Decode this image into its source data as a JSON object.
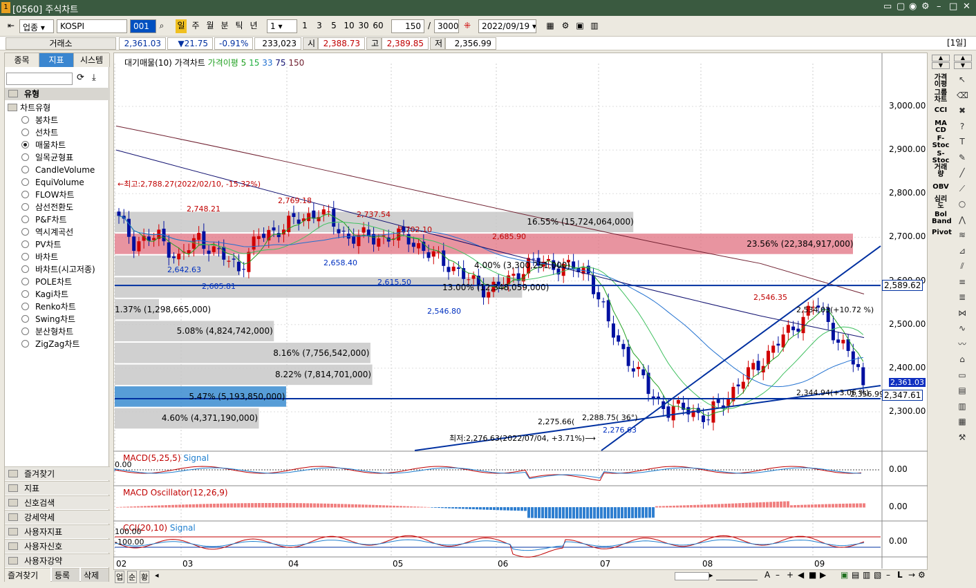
{
  "window": {
    "title": "[0560] 주식차트",
    "controls": [
      "□",
      "▢",
      "◉",
      "⚙",
      "–",
      "□",
      "✕"
    ]
  },
  "toolbar": {
    "market": "업종",
    "symbol": "KOSPI",
    "code": "001",
    "periods": [
      "일",
      "주",
      "월",
      "분",
      "틱",
      "년"
    ],
    "interval": "1",
    "quick": [
      "1",
      "3",
      "5",
      "10",
      "30",
      "60"
    ],
    "count": "150",
    "total": "3000",
    "date": "2022/09/19"
  },
  "pricebar": {
    "exchange": "거래소",
    "price": "2,361.03",
    "change": "▼21.75",
    "pct": "-0.91%",
    "volume": "233,023",
    "open_l": "시",
    "open": "2,388.73",
    "high_l": "고",
    "high": "2,389.85",
    "low_l": "저",
    "low": "2,356.99",
    "period": "[1일]"
  },
  "left": {
    "tabs": [
      "종목",
      "지표",
      "시스템"
    ],
    "section": "유형",
    "group": "차트유형",
    "types": [
      "봉차트",
      "선차트",
      "매물차트",
      "일목균형표",
      "CandleVolume",
      "EquiVolume",
      "FLOW차트",
      "삼선전환도",
      "P&F차트",
      "역시계곡선",
      "PV차트",
      "바차트",
      "바차트(시고저종)",
      "POLE차트",
      "Kagi차트",
      "Renko차트",
      "Swing차트",
      "분산형차트",
      "ZigZag차트"
    ],
    "selected": "매물차트",
    "bottom": [
      "즐겨찾기",
      "지표",
      "신호검색",
      "강세약세",
      "사용자지표",
      "사용자신호",
      "사용자강약"
    ],
    "footer": [
      "즐겨찾기",
      "등록",
      "삭제"
    ]
  },
  "legend": {
    "a": "대기매물(10)",
    "b": "가격차트",
    "c": "가격이평 5",
    "d": "15",
    "e": "33",
    "f": "75",
    "g": "150"
  },
  "macd": {
    "name": "MACD(5,25,5)",
    "sig": "Signal",
    "zero": "0.00",
    "val": "0.00"
  },
  "osc": {
    "name": "MACD Oscillator(12,26,9)",
    "val": "0.00"
  },
  "cci": {
    "name": "CCI(20,10)",
    "sig": "Signal",
    "p100": "100.00",
    "m100": "-100.00",
    "val": "0.00"
  },
  "bottombar": {
    "buttons": [
      "업",
      "순",
      "황"
    ]
  },
  "chart_data": {
    "type": "candlestick",
    "x_ticks": [
      "02",
      "03",
      "04",
      "05",
      "06",
      "07",
      "08",
      "09"
    ],
    "y_ticks": [
      "3,000.00",
      "2,900.00",
      "2,800.00",
      "2,700.00",
      "2,600.00",
      "2,500.00",
      "2,400.00",
      "2,300.00"
    ],
    "ylim": [
      2240,
      3080
    ],
    "current": "2,361.03",
    "level1": "2,589.62",
    "level2": "2,347.61",
    "volume_profile": [
      {
        "label": "16.55% (15,724,064,000)",
        "lo": 2710,
        "hi": 2760,
        "pct": 16.55
      },
      {
        "label": "23.56% (22,384,917,000)",
        "lo": 2660,
        "hi": 2710,
        "pct": 23.56
      },
      {
        "label": "4.00% (3,300,251,000)",
        "lo": 2610,
        "hi": 2660,
        "pct": 4.0
      },
      {
        "label": "13.00% (12,348,059,000)",
        "lo": 2560,
        "hi": 2610,
        "pct": 13.0
      },
      {
        "label": "1.37% (1,298,665,000)",
        "lo": 2510,
        "hi": 2560,
        "pct": 1.37
      },
      {
        "label": "5.08% (4,824,742,000)",
        "lo": 2460,
        "hi": 2510,
        "pct": 5.08
      },
      {
        "label": "8.16% (7,756,542,000)",
        "lo": 2410,
        "hi": 2460,
        "pct": 8.16
      },
      {
        "label": "8.22% (7,814,701,000)",
        "lo": 2360,
        "hi": 2410,
        "pct": 8.22
      },
      {
        "label": "5.47% (5,193,850,000)",
        "lo": 2310,
        "hi": 2360,
        "pct": 5.47
      },
      {
        "label": "4.60% (4,371,190,000)",
        "lo": 2260,
        "hi": 2310,
        "pct": 4.6
      }
    ],
    "annotations": [
      {
        "t": "←최고:2,788.27(2022/02/10, -15.32%)",
        "c": "#c00000"
      },
      {
        "t": "2,748.21",
        "c": "#c00000"
      },
      {
        "t": "2,769.18",
        "c": "#c00000"
      },
      {
        "t": "2,737.54",
        "c": "#c00000"
      },
      {
        "t": "2,702.10",
        "c": "#c00000"
      },
      {
        "t": "2,685.90",
        "c": "#c00000"
      },
      {
        "t": "2,546.35",
        "c": "#c00000"
      },
      {
        "t": "2,642.63",
        "c": "#0030c0"
      },
      {
        "t": "2,605.81",
        "c": "#0030c0"
      },
      {
        "t": "2,658.40",
        "c": "#0030c0"
      },
      {
        "t": "2,615.50",
        "c": "#0030c0"
      },
      {
        "t": "2,546.80",
        "c": "#0030c0"
      },
      {
        "t": "2,276.63",
        "c": "#0030c0"
      },
      {
        "t": "2,534.03(+10.72 %)",
        "c": "#000"
      },
      {
        "t": "2,275.66(",
        "c": "#000"
      },
      {
        "t": "2,288.75( 36°)",
        "c": "#000"
      },
      {
        "t": "2,344.94(+3.06 %)",
        "c": "#000"
      },
      {
        "t": "2,356.99",
        "c": "#000"
      },
      {
        "t": "최저:2,276.63(2022/07/04, +3.71%)⟶",
        "c": "#000"
      }
    ]
  },
  "right": {
    "labels": [
      "가격\n이평",
      "그룹\n차트",
      "CCI",
      "MA\nCD",
      "F-\nStoc",
      "S-\nStoc",
      "거래\n량",
      "OBV",
      "심리\n도",
      "Bol\nBand",
      "Pivot"
    ]
  }
}
